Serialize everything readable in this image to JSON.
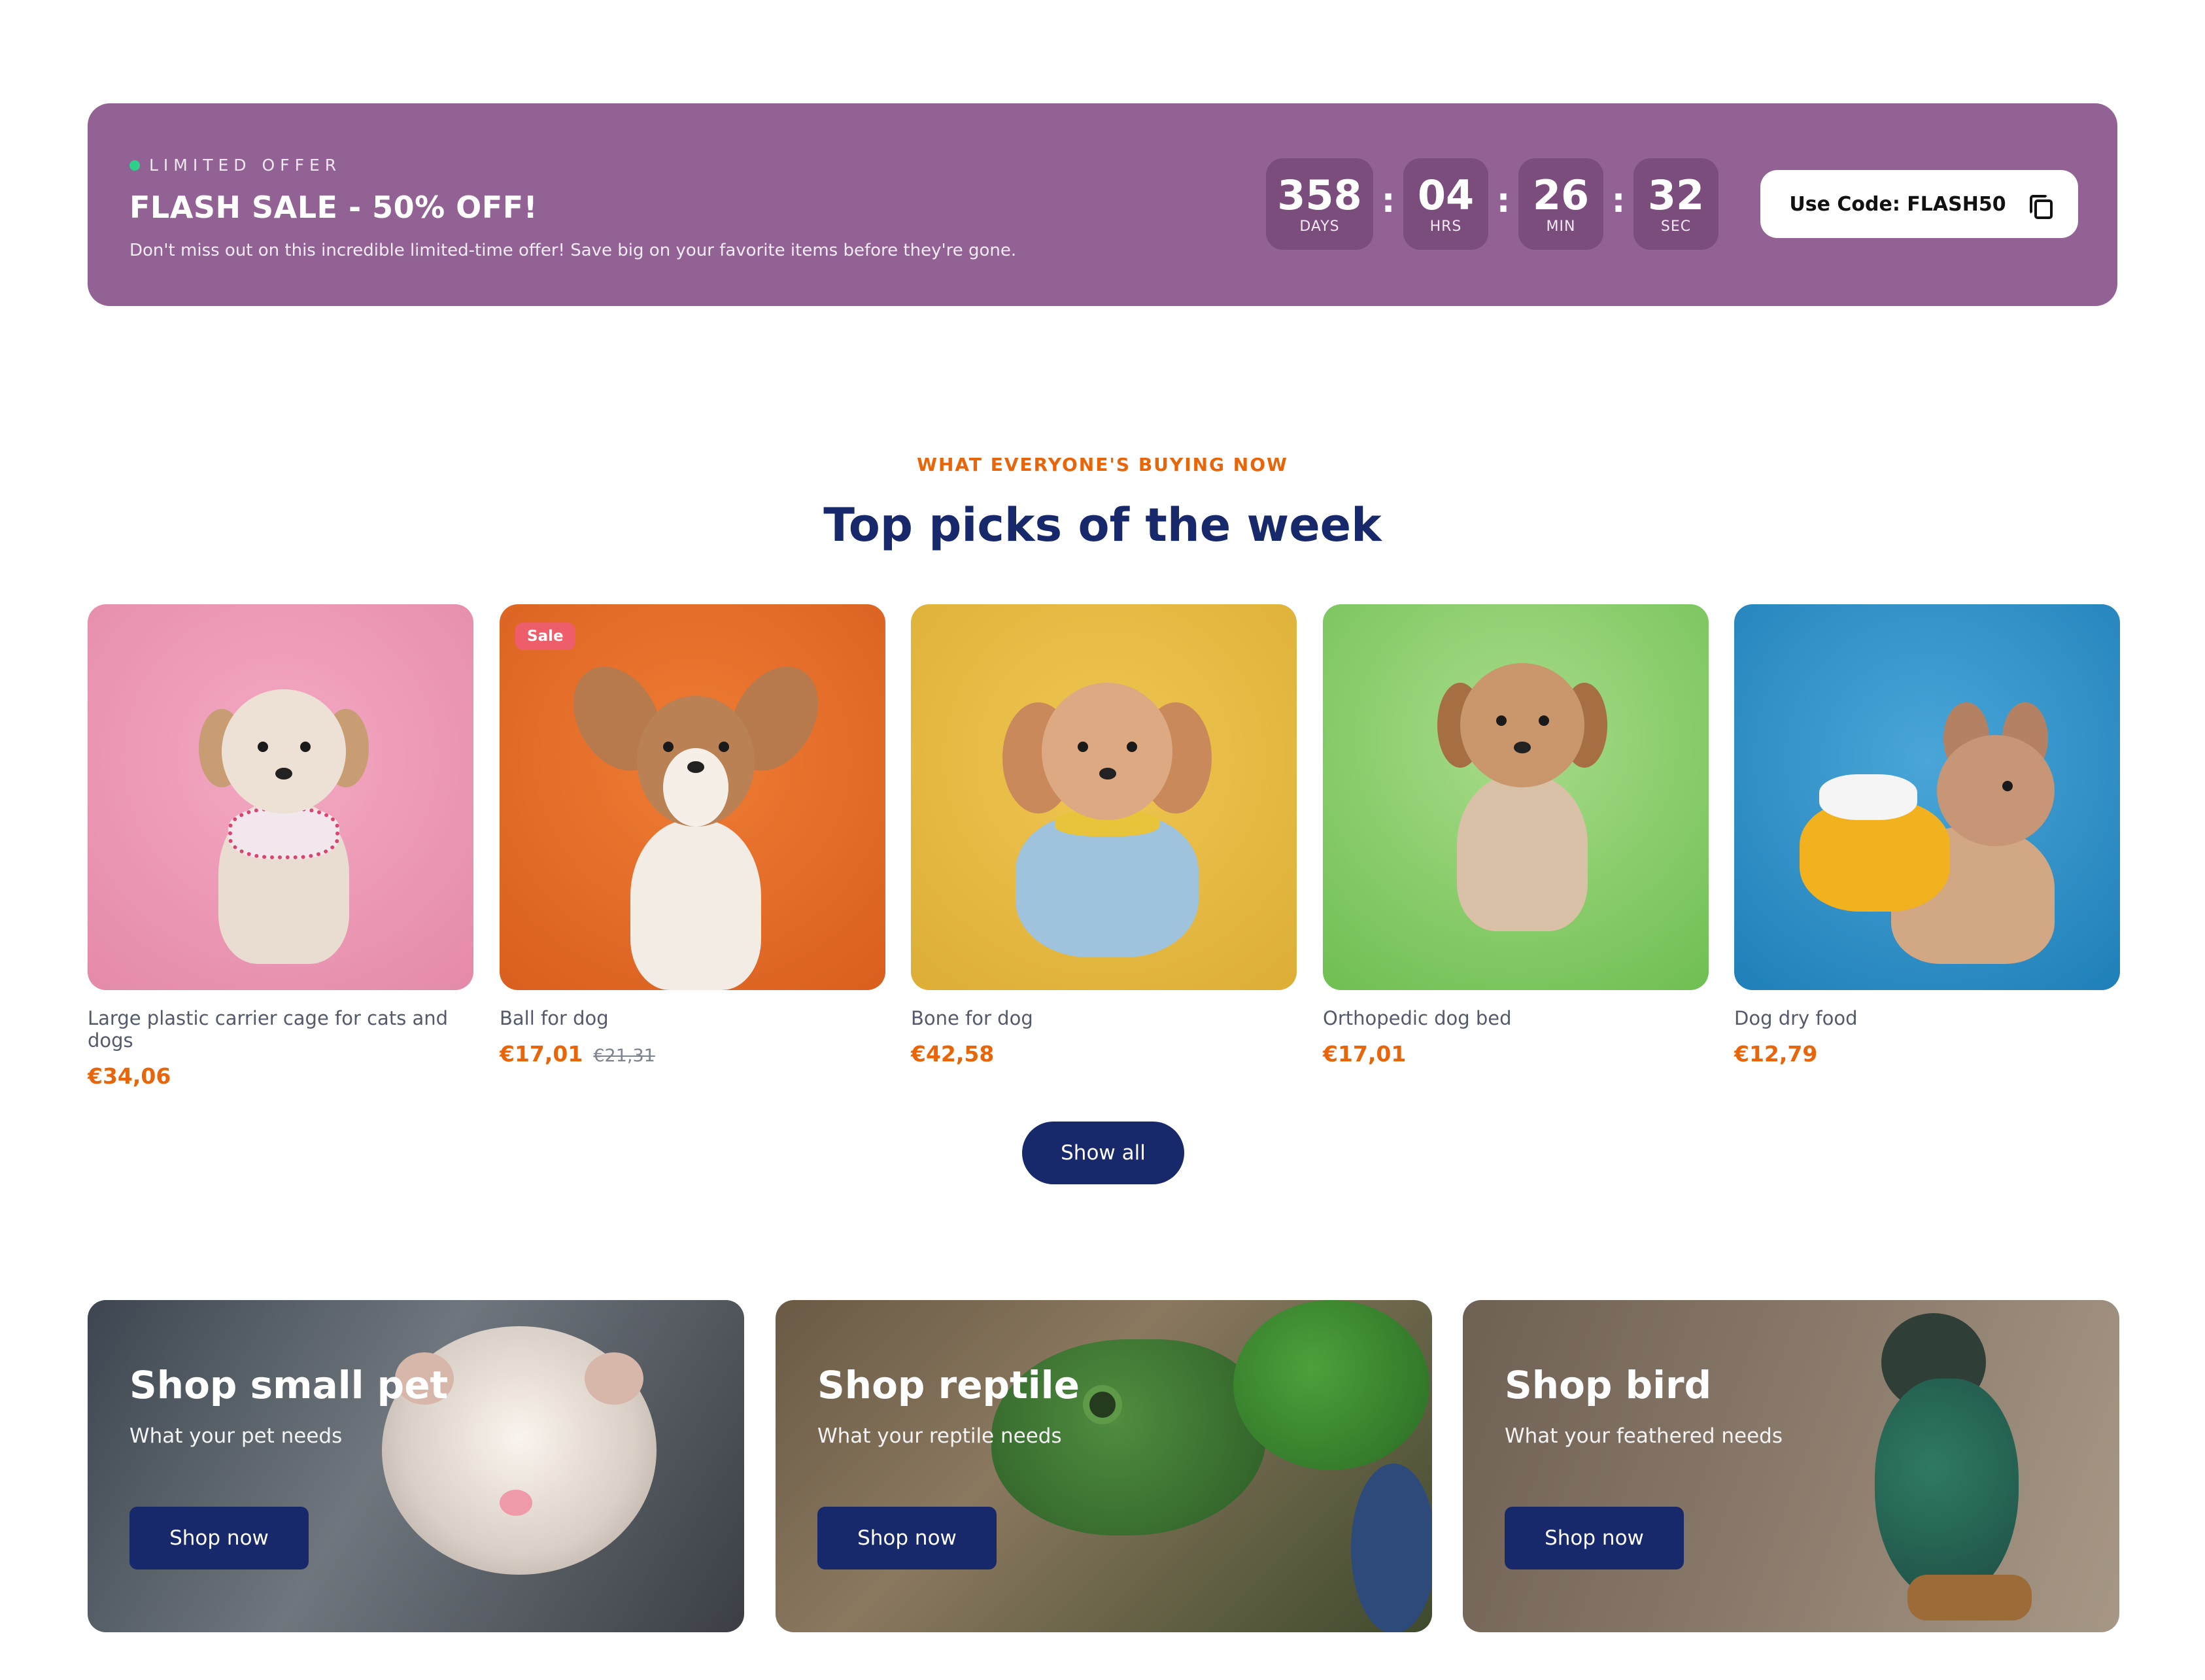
{
  "banner": {
    "tag": "LIMITED OFFER",
    "title": "FLASH SALE - 50% OFF!",
    "subtitle": "Don't miss out on this incredible limited-time offer! Save big on your favorite items before they're gone.",
    "countdown": [
      {
        "value": "358",
        "unit": "DAYS"
      },
      {
        "value": "04",
        "unit": "HRS"
      },
      {
        "value": "26",
        "unit": "MIN"
      },
      {
        "value": "32",
        "unit": "SEC"
      }
    ],
    "separator": ":",
    "code_label": "Use Code: FLASH50",
    "code_icon": "copy-icon",
    "bg_color": "#916293",
    "dot_color": "#2fd08c"
  },
  "top_picks": {
    "eyebrow": "WHAT EVERYONE'S BUYING NOW",
    "title": "Top picks of the week",
    "products": [
      {
        "name": "Large plastic carrier cage for cats and dogs",
        "price": "€34,06",
        "old_price": "",
        "badge": "",
        "bg": "#ee97b4"
      },
      {
        "name": "Ball for dog",
        "price": "€17,01",
        "old_price": "€21,31",
        "badge": "Sale",
        "bg": "#e66e2a"
      },
      {
        "name": "Bone for dog",
        "price": "€42,58",
        "old_price": "",
        "badge": "",
        "bg": "#ebbe45"
      },
      {
        "name": "Orthopedic dog bed",
        "price": "€17,01",
        "old_price": "",
        "badge": "",
        "bg": "#8fcf70"
      },
      {
        "name": "Dog dry food",
        "price": "€12,79",
        "old_price": "",
        "badge": "",
        "bg": "#2f8fc8"
      }
    ],
    "show_all": "Show all",
    "accent_color": "#e8650a",
    "brand_color": "#17286b"
  },
  "categories": [
    {
      "title": "Shop small pet",
      "subtitle": "What your pet needs",
      "button": "Shop now"
    },
    {
      "title": "Shop reptile",
      "subtitle": "What your reptile needs",
      "button": "Shop now"
    },
    {
      "title": "Shop bird",
      "subtitle": "What your feathered needs",
      "button": "Shop now"
    }
  ]
}
